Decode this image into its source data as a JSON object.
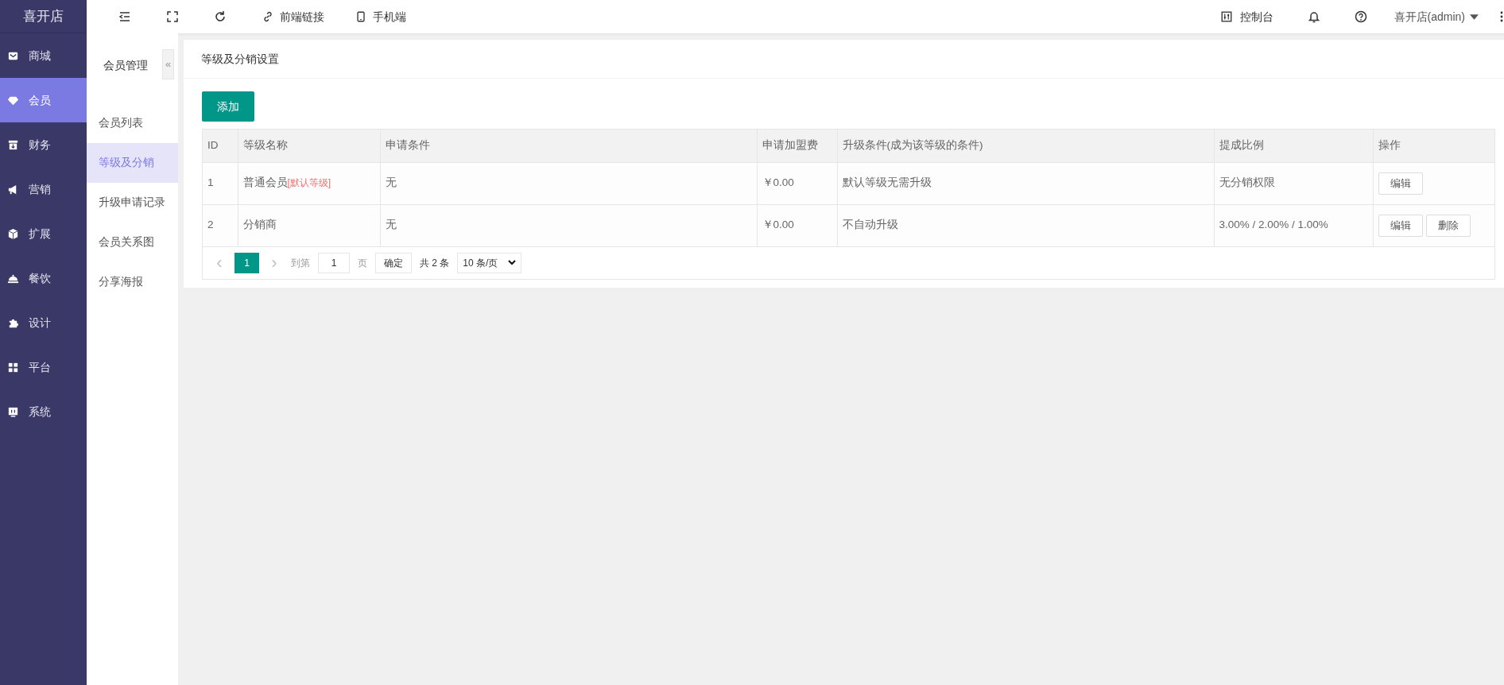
{
  "brand": "喜开店",
  "sidebar": {
    "items": [
      {
        "label": "商城",
        "selected": false
      },
      {
        "label": "会员",
        "selected": true
      },
      {
        "label": "财务",
        "selected": false
      },
      {
        "label": "营销",
        "selected": false
      },
      {
        "label": "扩展",
        "selected": false
      },
      {
        "label": "餐饮",
        "selected": false
      },
      {
        "label": "设计",
        "selected": false
      },
      {
        "label": "平台",
        "selected": false
      },
      {
        "label": "系统",
        "selected": false
      }
    ]
  },
  "toolbar": {
    "links": [
      "前端链接",
      "手机端"
    ],
    "console": "控制台",
    "user": "喜开店(admin)"
  },
  "subnav": {
    "title": "会员管理",
    "collapse": "«",
    "items": [
      {
        "label": "会员列表",
        "selected": false
      },
      {
        "label": "等级及分销",
        "selected": true
      },
      {
        "label": "升级申请记录",
        "selected": false
      },
      {
        "label": "会员关系图",
        "selected": false
      },
      {
        "label": "分享海报",
        "selected": false
      }
    ]
  },
  "panel": {
    "title": "等级及分销设置",
    "add_button": "添加"
  },
  "table": {
    "columns": [
      "ID",
      "等级名称",
      "申请条件",
      "申请加盟费",
      "升级条件(成为该等级的条件)",
      "提成比例",
      "操作"
    ],
    "rows": [
      {
        "id": "1",
        "name": "普通会员",
        "tag": "[默认等级]",
        "condition": "无",
        "fee": "￥0.00",
        "upgrade": "默认等级无需升级",
        "commission": "无分销权限",
        "actions": [
          "编辑"
        ]
      },
      {
        "id": "2",
        "name": "分销商",
        "condition": "无",
        "fee": "￥0.00",
        "upgrade": "不自动升级",
        "commission": "3.00% / 2.00% / 1.00%",
        "actions": [
          "编辑",
          "删除"
        ]
      }
    ]
  },
  "pagination": {
    "prev": "‹",
    "pages": [
      {
        "label": "1",
        "selected": true
      }
    ],
    "next": "›",
    "goto_label": "到第",
    "goto_value": "1",
    "page_label": "页",
    "confirm": "确定",
    "total": "共 2 条",
    "page_size": "10 条/页"
  }
}
